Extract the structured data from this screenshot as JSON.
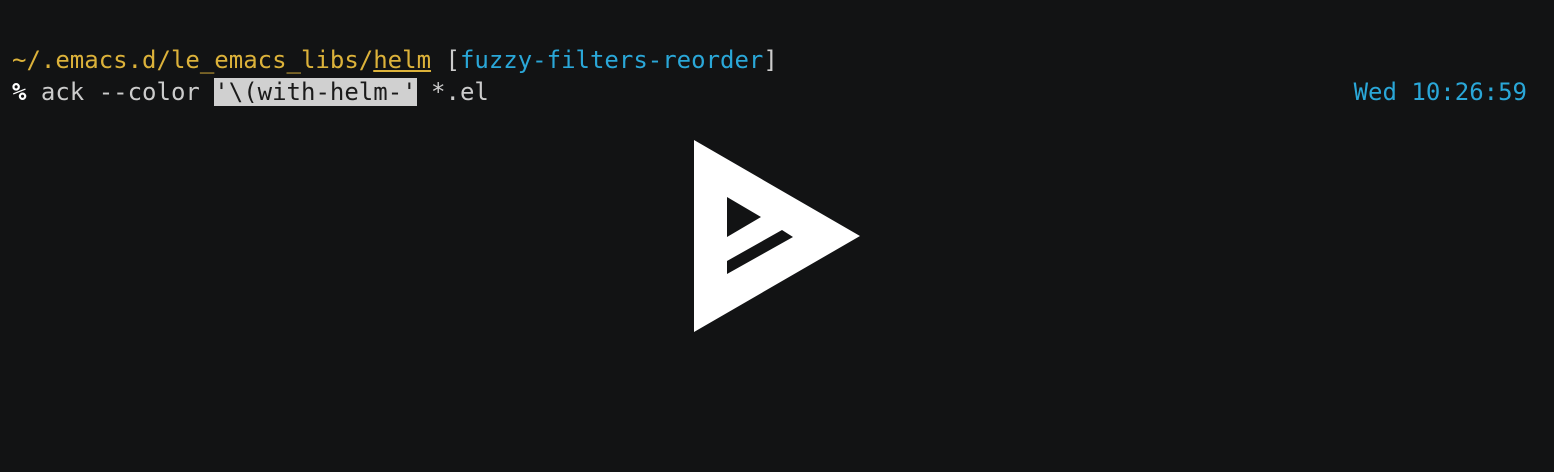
{
  "prompt_line": {
    "path_prefix": "~/.emacs.d/le_emacs_libs/",
    "path_last": "helm",
    "bracket_open": " [",
    "branch": "fuzzy-filters-reorder",
    "bracket_close": "]"
  },
  "command_line": {
    "prompt_symbol": "%",
    "before_highlight": " ack --color ",
    "highlighted": "'\\(with-helm-'",
    "after_highlight": " *.el"
  },
  "clock": "Wed 10:26:59",
  "overlay": {
    "icon": "asciinema-play-icon"
  },
  "colors": {
    "background": "#121314",
    "path": "#dcb23a",
    "branch": "#2aa7d8",
    "clock": "#2aa7d8",
    "highlight_bg": "#d0d0d0"
  }
}
